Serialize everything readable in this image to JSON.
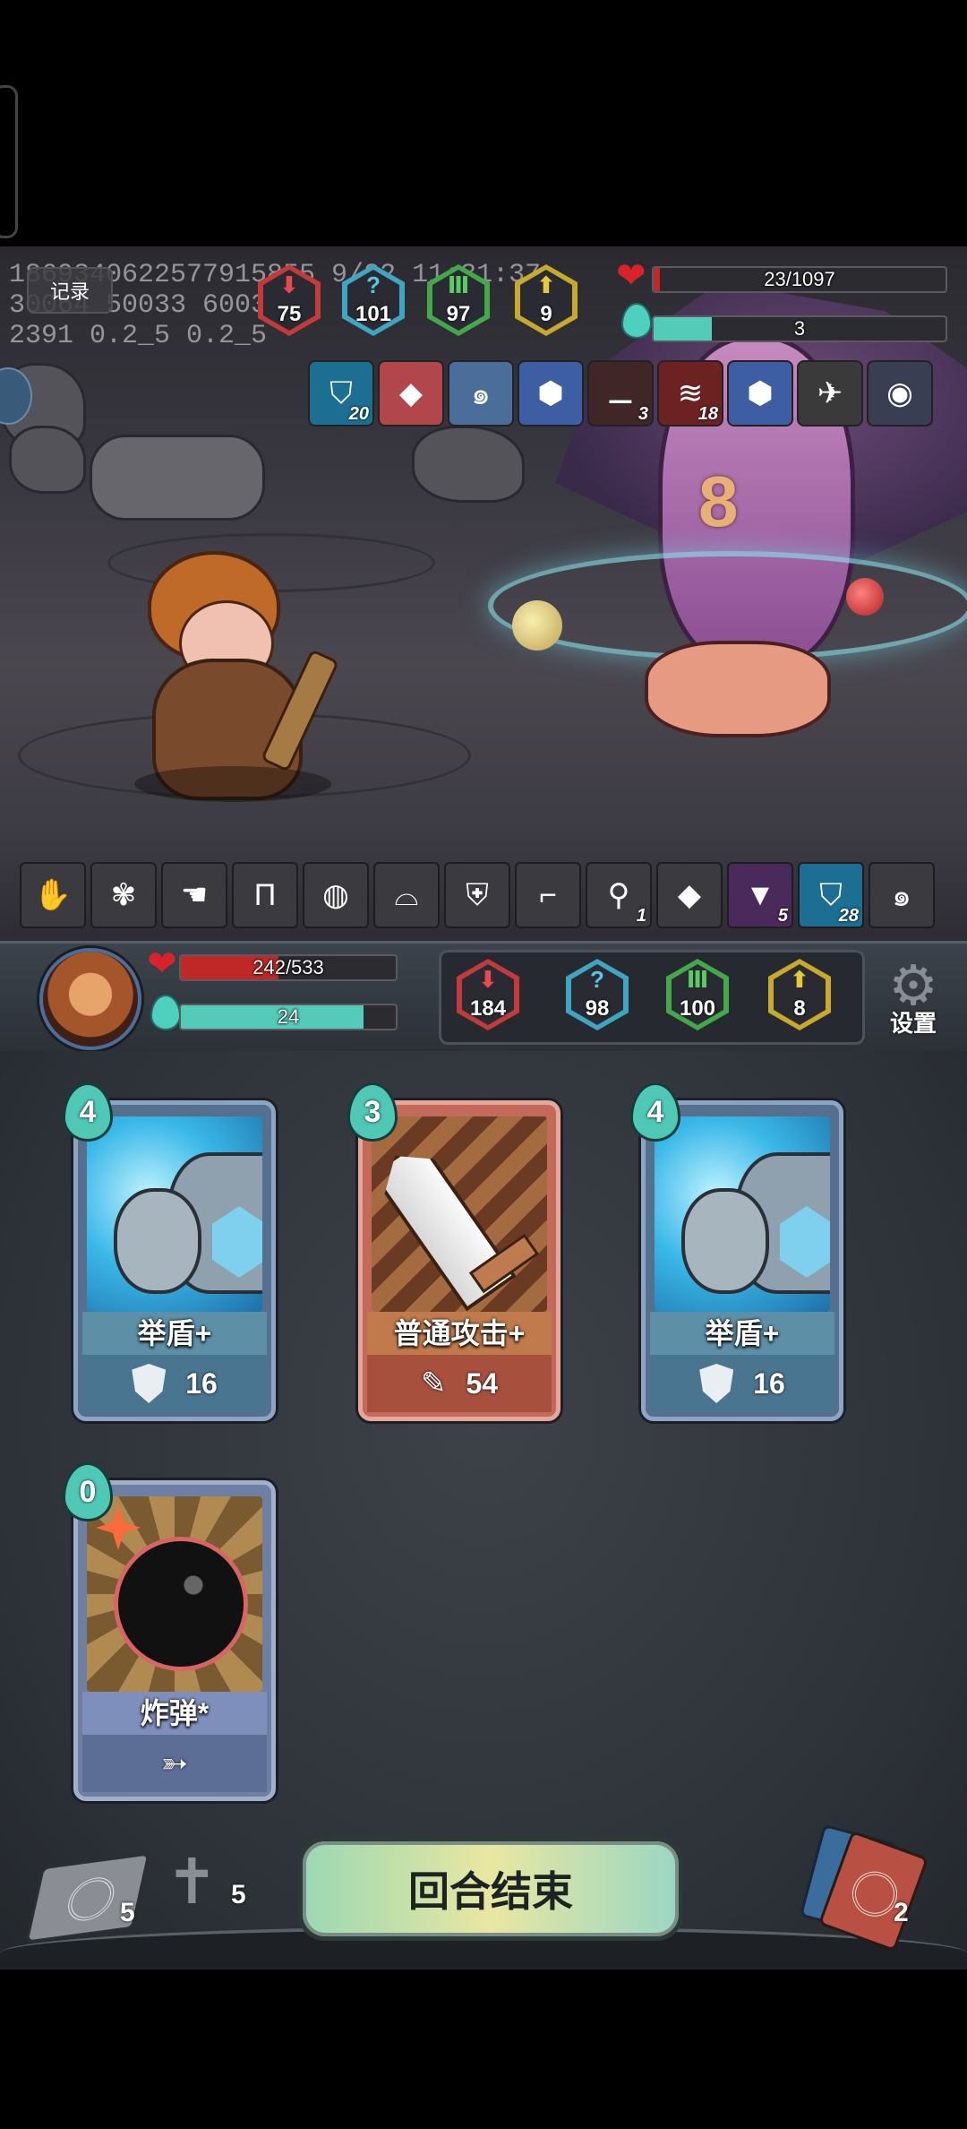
{
  "debug": {
    "line1": "1869340622577915855 9/22 11:31:37",
    "line2": "30064 50033 60031",
    "line3": "2391 0.2_5 0.2_5"
  },
  "record_label": "记录",
  "enemy": {
    "hp_text": "23/1097",
    "hp_fraction": 0.021,
    "energy_text": "3",
    "energy_fraction": 0.2,
    "stats": [
      {
        "name": "attack",
        "value": "75",
        "color": "#c23a3a",
        "icon": "down-arrow-icon"
      },
      {
        "name": "crit",
        "value": "101",
        "color": "#3fa6c2",
        "icon": "question-icon"
      },
      {
        "name": "defense",
        "value": "97",
        "color": "#43a84c",
        "icon": "pillar-icon"
      },
      {
        "name": "speed",
        "value": "9",
        "color": "#c6a92d",
        "icon": "up-arrow-icon"
      }
    ],
    "buffs": [
      {
        "icon": "shield-icon",
        "count": "20",
        "bg": "#1c6f92"
      },
      {
        "icon": "crystal-icon",
        "count": "",
        "bg": "#b1474c"
      },
      {
        "icon": "swirl-icon",
        "count": "",
        "bg": "#4a6d9a"
      },
      {
        "icon": "hex-shield-icon",
        "count": "",
        "bg": "#3d5ea3"
      },
      {
        "icon": "blade-flash-icon",
        "count": "3",
        "bg": "#402626"
      },
      {
        "icon": "claw-icon",
        "count": "18",
        "bg": "#6d2222"
      },
      {
        "icon": "hex-shield-icon",
        "count": "",
        "bg": "#3d5ea3"
      },
      {
        "icon": "bird-icon",
        "count": "",
        "bg": "#3a3a3a"
      },
      {
        "icon": "planet-icon",
        "count": "",
        "bg": "#3a3e52"
      }
    ]
  },
  "relics": [
    {
      "icon": "glove-icon",
      "count": ""
    },
    {
      "icon": "moth-icon",
      "count": ""
    },
    {
      "icon": "hand-icon",
      "count": ""
    },
    {
      "icon": "pants-icon",
      "count": ""
    },
    {
      "icon": "sack-icon",
      "count": ""
    },
    {
      "icon": "helmet-icon",
      "count": ""
    },
    {
      "icon": "armor-icon",
      "count": ""
    },
    {
      "icon": "gun-icon",
      "count": ""
    },
    {
      "icon": "bone-icon",
      "count": "1"
    },
    {
      "icon": "crystal-icon",
      "count": ""
    },
    {
      "icon": "hood-icon",
      "count": "5"
    },
    {
      "icon": "shield-icon",
      "count": "28"
    },
    {
      "icon": "swirl-icon",
      "count": ""
    }
  ],
  "player": {
    "hp_text": "242/533",
    "hp_fraction": 0.454,
    "energy_text": "24",
    "energy_fraction": 0.85,
    "stats": [
      {
        "name": "attack",
        "value": "184",
        "color": "#c23a3a"
      },
      {
        "name": "crit",
        "value": "98",
        "color": "#3fa6c2"
      },
      {
        "name": "defense",
        "value": "100",
        "color": "#43a84c"
      },
      {
        "name": "speed",
        "value": "8",
        "color": "#c6a92d"
      }
    ],
    "settings_label": "设置"
  },
  "cards": [
    {
      "cost": "4",
      "name": "举盾+",
      "value": "16",
      "effect_icon": "shield-icon",
      "type": "defense"
    },
    {
      "cost": "3",
      "name": "普通攻击+",
      "value": "54",
      "effect_icon": "slash-icon",
      "type": "attack"
    },
    {
      "cost": "4",
      "name": "举盾+",
      "value": "16",
      "effect_icon": "shield-icon",
      "type": "defense"
    },
    {
      "cost": "0",
      "name": "炸弹*",
      "value": "",
      "effect_icon": "arrow-icon",
      "type": "special"
    }
  ],
  "bottom": {
    "draw_pile_count": "5",
    "discard_pile_count": "5",
    "end_turn_label": "回合结束",
    "exhaust_pile_count": "2"
  }
}
